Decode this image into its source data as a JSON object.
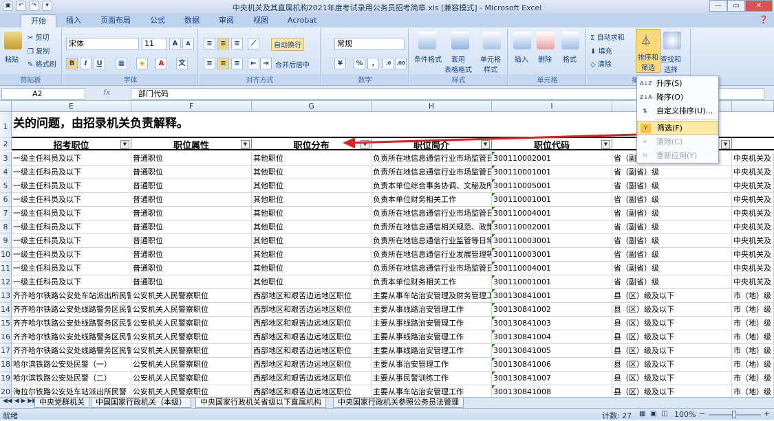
{
  "window": {
    "title": "中央机关及其直属机构2021年度考试录用公务员招考简章.xls  [兼容模式] - Microsoft Excel",
    "minimize": "—",
    "restore": "▭",
    "close": "✕"
  },
  "qat": [
    "▣",
    "↶",
    "↷",
    "▾"
  ],
  "tabs": [
    "开始",
    "插入",
    "页面布局",
    "公式",
    "数据",
    "审阅",
    "视图",
    "Acrobat"
  ],
  "help": "❓",
  "ribbon": {
    "clipboard": {
      "label": "剪贴板",
      "paste": "粘贴",
      "cut": "剪切",
      "copy": "复制",
      "format_painter": "格式刷"
    },
    "font": {
      "label": "字体",
      "name": "宋体",
      "size": "11",
      "bold": "B",
      "italic": "I",
      "underline": "U",
      "grow": "A",
      "shrink": "A"
    },
    "alignment": {
      "label": "对齐方式",
      "wrap": "自动换行",
      "merge": "合并后居中"
    },
    "number": {
      "label": "数字",
      "format": "常规",
      "percent": "%",
      "comma": ","
    },
    "styles": {
      "label": "样式",
      "conditional": "条件格式",
      "table": "套用\n表格格式",
      "cell": "单元格\n样式"
    },
    "cells": {
      "label": "单元格",
      "insert": "插入",
      "delete": "删除",
      "format": "格式"
    },
    "editing": {
      "label": "编辑",
      "autosum": "自动求和",
      "fill": "填充",
      "clear": "清除",
      "sort": "排序和\n筛选",
      "find": "查找和\n选择"
    }
  },
  "formula_bar": {
    "name_box": "A2",
    "fx": "fx",
    "content": "部门代码"
  },
  "columns": [
    "E",
    "F",
    "G",
    "H",
    "I"
  ],
  "row1_text": "关的问题，由招录机关负责解释。",
  "headers": [
    "招考职位",
    "职位属性",
    "职位分布",
    "职位简介",
    "职位代码"
  ],
  "rows": [
    {
      "n": "3",
      "e": "一级主任科员及以下",
      "f": "普通职位",
      "g": "其他职位",
      "h": "负责所在地信息通信行业市场监管日",
      "i": "300110002001",
      "j": "省（副省）级",
      "k": "中央机关及"
    },
    {
      "n": "4",
      "e": "一级主任科员及以下",
      "f": "普通职位",
      "g": "其他职位",
      "h": "负责所在地信息通信行业市场监管日",
      "i": "300110001001",
      "j": "省（副省）级",
      "k": "中央机关及"
    },
    {
      "n": "5",
      "e": "一级主任科员及以下",
      "f": "普通职位",
      "g": "其他职位",
      "h": "负责本单位综合事务协调、文秘及所",
      "i": "300110005001",
      "j": "省（副省）级",
      "k": "中央机关及"
    },
    {
      "n": "6",
      "e": "一级主任科员及以下",
      "f": "普通职位",
      "g": "其他职位",
      "h": "负责本单位财务相关工作",
      "i": "300110001001",
      "j": "省（副省）级",
      "k": "中央机关及"
    },
    {
      "n": "7",
      "e": "一级主任科员及以下",
      "f": "普通职位",
      "g": "其他职位",
      "h": "负责所在地信息通信行业市场监管日",
      "i": "300110004001",
      "j": "省（副省）级",
      "k": "中央机关及"
    },
    {
      "n": "8",
      "e": "一级主任科员及以下",
      "f": "普通职位",
      "g": "其他职位",
      "h": "负责所在地信息通信相关规范、政策",
      "i": "300110002001",
      "j": "省（副省）级",
      "k": "中央机关及"
    },
    {
      "n": "9",
      "e": "一级主任科员及以下",
      "f": "普通职位",
      "g": "其他职位",
      "h": "负责所在地信息通信行业监管等日常",
      "i": "300110003001",
      "j": "省（副省）级",
      "k": "中央机关及"
    },
    {
      "n": "10",
      "e": "一级主任科员及以下",
      "f": "普通职位",
      "g": "其他职位",
      "h": "负责所在地信息通信行业发展管理等",
      "i": "300110003001",
      "j": "省（副省）级",
      "k": "中央机关及"
    },
    {
      "n": "11",
      "e": "一级主任科员及以下",
      "f": "普通职位",
      "g": "其他职位",
      "h": "负责所在地信息通信行业市场监管日",
      "i": "300110004001",
      "j": "省（副省）级",
      "k": "中央机关及"
    },
    {
      "n": "12",
      "e": "一级主任科员及以下",
      "f": "普通职位",
      "g": "其他职位",
      "h": "负责本单位财务相关工作",
      "i": "300110001001",
      "j": "省（副省）级",
      "k": "中央机关及"
    },
    {
      "n": "13",
      "e": "齐齐哈尔铁路公安处车站派出所民警",
      "f": "公安机关人民警察职位",
      "g": "西部地区和艰苦边远地区职位",
      "h": "主要从事车站治安管理及财务管理工",
      "i": "300130841001",
      "j": "县（区）级及以下",
      "k": "市（地）级"
    },
    {
      "n": "14",
      "e": "齐齐哈尔铁路公安处线路警务区民警",
      "f": "公安机关人民警察职位",
      "g": "西部地区和艰苦边远地区职位",
      "h": "主要从事线路治安管理工作",
      "i": "300130841002",
      "j": "县（区）级及以下",
      "k": "市（地）级"
    },
    {
      "n": "15",
      "e": "齐齐哈尔铁路公安处线路警务区民警",
      "f": "公安机关人民警察职位",
      "g": "西部地区和艰苦边远地区职位",
      "h": "主要从事线路治安管理工作",
      "i": "300130841003",
      "j": "县（区）级及以下",
      "k": "市（地）级"
    },
    {
      "n": "16",
      "e": "齐齐哈尔铁路公安处线路警务区民警",
      "f": "公安机关人民警察职位",
      "g": "西部地区和艰苦边远地区职位",
      "h": "主要从事线路治安管理工作",
      "i": "300130841004",
      "j": "县（区）级及以下",
      "k": "市（地）级"
    },
    {
      "n": "17",
      "e": "齐齐哈尔铁路公安处线路警务区民警",
      "f": "公安机关人民警察职位",
      "g": "西部地区和艰苦边远地区职位",
      "h": "主要从事线路治安管理工作",
      "i": "300130841005",
      "j": "县（区）级及以下",
      "k": "市（地）级"
    },
    {
      "n": "18",
      "e": "哈尔滨铁路公安处民警（一）",
      "f": "公安机关人民警察职位",
      "g": "西部地区和艰苦边远地区职位",
      "h": "主要从事治安管理工作",
      "i": "300130841006",
      "j": "县（区）级及以下",
      "k": "市（地）级"
    },
    {
      "n": "19",
      "e": "哈尔滨铁路公安处民警（二）",
      "f": "公安机关人民警察职位",
      "g": "西部地区和艰苦边远地区职位",
      "h": "主要从事民警训练工作",
      "i": "300130841007",
      "j": "县（区）级及以下",
      "k": "市（地）级"
    },
    {
      "n": "20",
      "e": "海拉尔铁路公安处车站派出所民警",
      "f": "公安机关人民警察职位",
      "g": "西部地区和艰苦边远地区职位",
      "h": "主要从事车站治安管理工作",
      "i": "300130841008",
      "j": "县（区）级及以下",
      "k": "市（地）级"
    }
  ],
  "sheets": [
    "中央党群机关",
    "中国国家行政机关（本级）",
    "中央国家行政机关省级以下直属机构",
    "中央国家行政机关参照公务员法管理"
  ],
  "status": {
    "ready": "就绪",
    "count": "计数: 27",
    "zoom": "100%",
    "minus": "−",
    "plus": "+"
  },
  "menu": {
    "asc": "升序(S)",
    "desc": "降序(O)",
    "custom": "自定义排序(U)...",
    "filter": "筛选(F)",
    "clear": "清除(C)",
    "reapply": "重新应用(Y)"
  },
  "accent": "#e02020"
}
